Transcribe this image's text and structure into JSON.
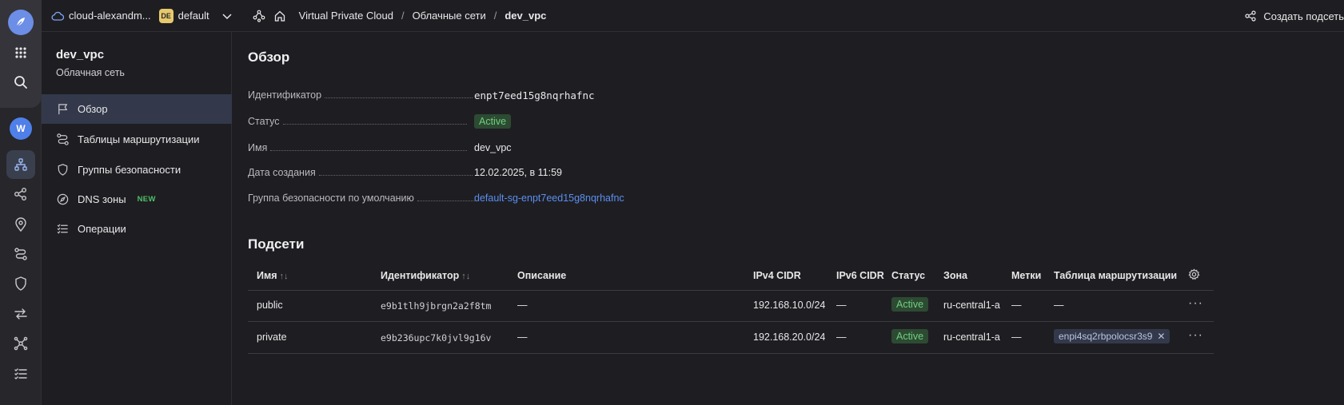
{
  "topbar": {
    "cloud_name": "cloud-alexandm...",
    "org_badge": "DE",
    "folder": "default",
    "breadcrumbs": [
      "Virtual Private Cloud",
      "Облачные сети",
      "dev_vpc"
    ],
    "create_subnet_label": "Создать подсеть"
  },
  "sidebar": {
    "title": "dev_vpc",
    "subtitle": "Облачная сеть",
    "workspace_initial": "W",
    "items": [
      {
        "label": "Обзор",
        "icon": "flag-icon"
      },
      {
        "label": "Таблицы маршрутизации",
        "icon": "route-icon"
      },
      {
        "label": "Группы безопасности",
        "icon": "shield-icon"
      },
      {
        "label": "DNS зоны",
        "icon": "compass-icon",
        "badge": "NEW"
      },
      {
        "label": "Операции",
        "icon": "list-icon"
      }
    ]
  },
  "overview": {
    "title": "Обзор",
    "properties": [
      {
        "label": "Идентификатор",
        "value": "enpt7eed15g8nqrhafnc"
      },
      {
        "label": "Статус",
        "value": "Active"
      },
      {
        "label": "Имя",
        "value": "dev_vpc"
      },
      {
        "label": "Дата создания",
        "value": "12.02.2025, в 11:59"
      },
      {
        "label": "Группа безопасности по умолчанию",
        "value": "default-sg-enpt7eed15g8nqrhafnc"
      }
    ]
  },
  "subnets": {
    "title": "Подсети",
    "columns": [
      "Имя",
      "Идентификатор",
      "Описание",
      "IPv4 CIDR",
      "IPv6 CIDR",
      "Статус",
      "Зона",
      "Метки",
      "Таблица маршрутизации"
    ],
    "rows": [
      {
        "name": "public",
        "id": "e9b1tlh9jbrgn2a2f8tm",
        "description": "—",
        "ipv4": "192.168.10.0/24",
        "ipv6": "—",
        "status": "Active",
        "zone": "ru-central1-a",
        "labels": "—",
        "route_table": "—"
      },
      {
        "name": "private",
        "id": "e9b236upc7k0jvl9g16v",
        "description": "—",
        "ipv4": "192.168.20.0/24",
        "ipv6": "—",
        "status": "Active",
        "zone": "ru-central1-a",
        "labels": "—",
        "route_table": "enpi4sq2rbpolocsr3s9"
      }
    ]
  },
  "colors": {
    "background": "#1e1e22",
    "accent": "#5b8ef0",
    "status_active_bg": "#2d4a32",
    "status_active_text": "#6fcf7f",
    "new_badge": "#4fbf6a"
  }
}
